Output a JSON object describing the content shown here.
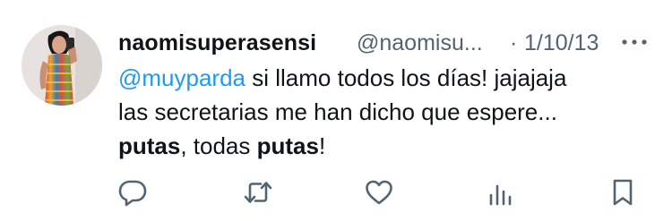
{
  "tweet": {
    "display_name": "naomisuperasensi",
    "handle": "@naomisu...",
    "separator": "·",
    "timestamp": "1/10/13",
    "body": {
      "mention": "@muyparda",
      "line1_rest": " si llamo todos los días! jajajaja",
      "line2": "las secretarias me han dicho que espere...",
      "line3_bold1": "putas",
      "line3_mid": ", todas ",
      "line3_bold2": "putas",
      "line3_end": "!"
    }
  },
  "icons": {
    "more": "more-horizontal-icon",
    "reply": "reply-icon",
    "retweet": "retweet-icon",
    "like": "heart-icon",
    "views": "views-icon",
    "bookmark": "bookmark-icon"
  },
  "colors": {
    "text": "#0f1419",
    "secondary": "#536471",
    "link": "#1d9bf0",
    "background": "#ffffff"
  }
}
